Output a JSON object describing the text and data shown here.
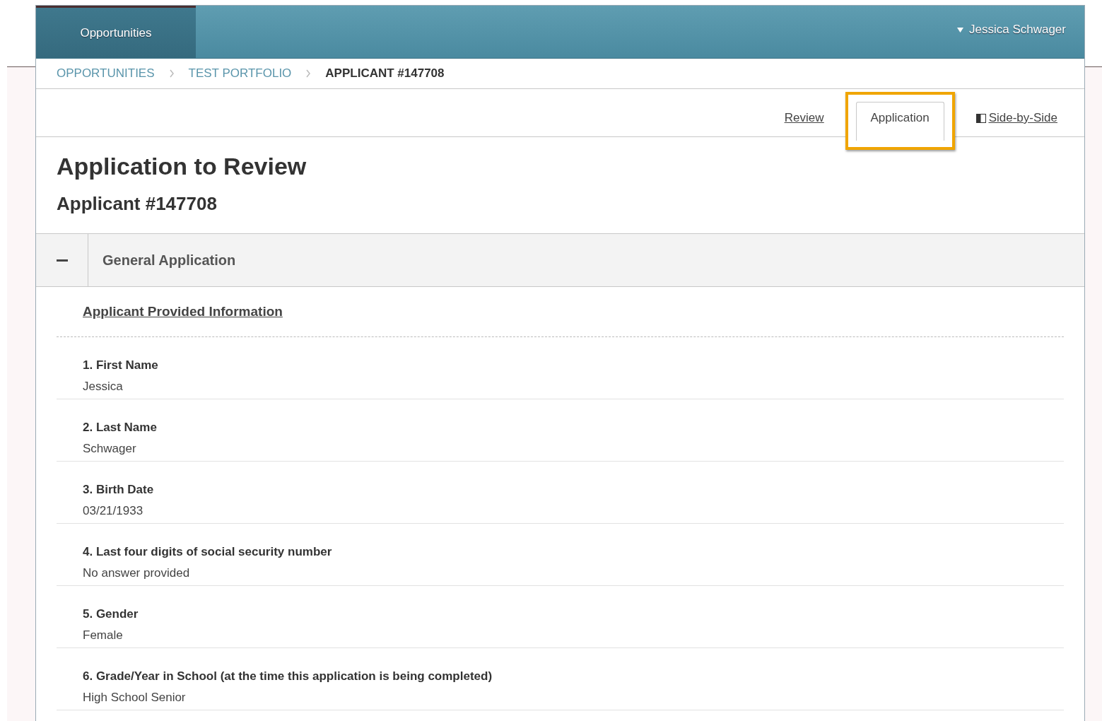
{
  "nav": {
    "tabs": [
      {
        "label": "Opportunities",
        "selected": true
      }
    ],
    "user": "Jessica Schwager"
  },
  "breadcrumb": [
    {
      "label": "OPPORTUNITIES",
      "current": false
    },
    {
      "label": "TEST PORTFOLIO",
      "current": false
    },
    {
      "label": "APPLICANT #147708",
      "current": true
    }
  ],
  "view_tabs": [
    {
      "label": "Review",
      "selected": false,
      "highlighted": false,
      "kind": "plain"
    },
    {
      "label": "Application",
      "selected": true,
      "highlighted": true,
      "kind": "plain"
    },
    {
      "label": "Side-by-Side",
      "selected": false,
      "highlighted": false,
      "kind": "split"
    }
  ],
  "title": "Application to Review",
  "subtitle": "Applicant #147708",
  "section": {
    "title": "General Application",
    "expanded": true,
    "link": "Applicant Provided Information",
    "questions": [
      {
        "label": "1. First Name",
        "answer": "Jessica"
      },
      {
        "label": "2. Last Name",
        "answer": "Schwager"
      },
      {
        "label": "3. Birth Date",
        "answer": "03/21/1933"
      },
      {
        "label": "4. Last four digits of social security number",
        "answer": "No answer provided"
      },
      {
        "label": "5. Gender",
        "answer": "Female"
      },
      {
        "label": "6. Grade/Year in School (at the time this application is being completed)",
        "answer": "High School Senior"
      }
    ]
  }
}
